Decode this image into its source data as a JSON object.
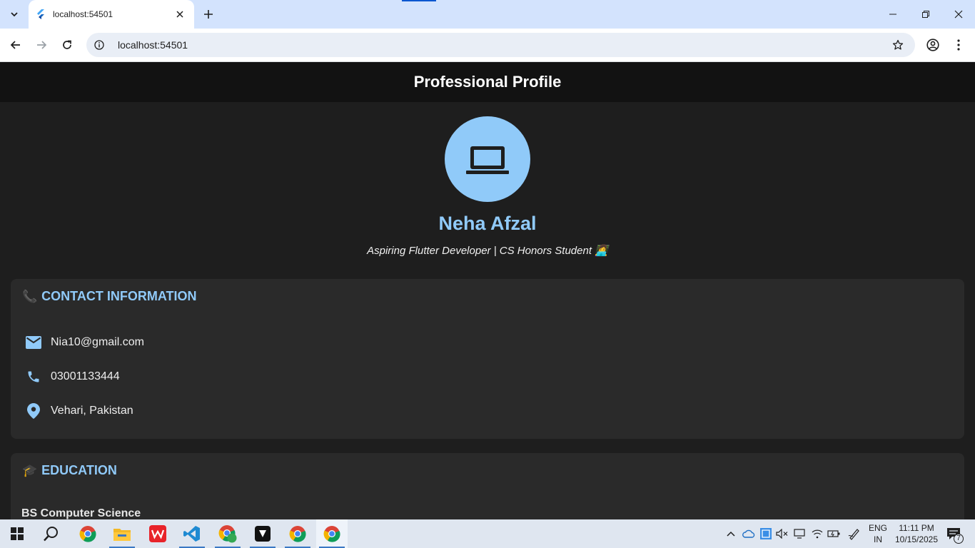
{
  "browser": {
    "tab_title": "localhost:54501",
    "url": "localhost:54501"
  },
  "app": {
    "title": "Professional Profile",
    "name": "Neha Afzal",
    "tagline": "Aspiring Flutter Developer | CS Honors Student 👩‍💻"
  },
  "contact": {
    "emoji": "📞",
    "title": "CONTACT INFORMATION",
    "items": [
      {
        "icon": "email-icon",
        "text": "Nia10@gmail.com"
      },
      {
        "icon": "phone-icon",
        "text": "03001133444"
      },
      {
        "icon": "location-pin-icon",
        "text": "Vehari, Pakistan"
      }
    ]
  },
  "education": {
    "emoji": "🎓",
    "title": "EDUCATION",
    "degree": "BS Computer Science"
  },
  "taskbar": {
    "lang_top": "ENG",
    "lang_bottom": "IN",
    "time": "11:11 PM",
    "date": "10/15/2025",
    "notifications": "7"
  },
  "colors": {
    "accent": "#90caf9",
    "appbar": "#121212",
    "background": "#1e1e1e",
    "card": "#2a2a2a"
  }
}
